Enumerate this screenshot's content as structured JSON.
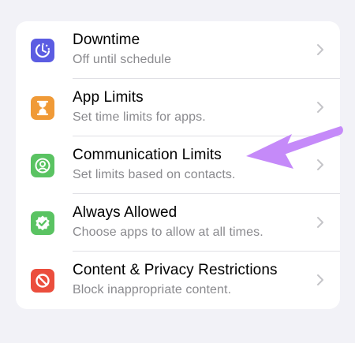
{
  "settings": {
    "items": [
      {
        "title": "Downtime",
        "subtitle": "Off until schedule",
        "icon": "downtime-icon",
        "color": "#5b5ce2"
      },
      {
        "title": "App Limits",
        "subtitle": "Set time limits for apps.",
        "icon": "hourglass-icon",
        "color": "#f09a37"
      },
      {
        "title": "Communication Limits",
        "subtitle": "Set limits based on contacts.",
        "icon": "person-circle-icon",
        "color": "#5ac362"
      },
      {
        "title": "Always Allowed",
        "subtitle": "Choose apps to allow at all times.",
        "icon": "checkmark-seal-icon",
        "color": "#5ac362"
      },
      {
        "title": "Content & Privacy Restrictions",
        "subtitle": "Block inappropriate content.",
        "icon": "restricted-icon",
        "color": "#eb4e3d"
      }
    ]
  },
  "annotation": {
    "arrow_color": "#c58af9"
  }
}
